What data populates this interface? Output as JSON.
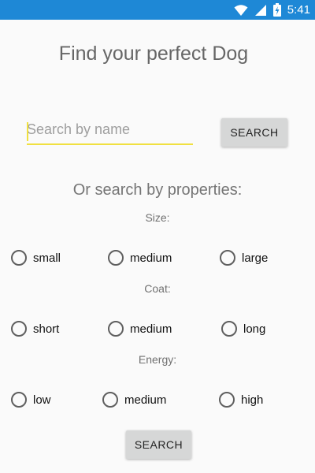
{
  "status_bar": {
    "time": "5:41",
    "icons": [
      "wifi-icon",
      "signal-icon",
      "battery-charging-icon"
    ],
    "color": "#1e88d6"
  },
  "title": "Find your perfect Dog",
  "search": {
    "placeholder": "Search by name",
    "value": "",
    "button_label": "SEARCH"
  },
  "properties_heading": "Or search by properties:",
  "groups": {
    "size": {
      "label": "Size:",
      "options": [
        "small",
        "medium",
        "large"
      ]
    },
    "coat": {
      "label": "Coat:",
      "options": [
        "short",
        "medium",
        "long"
      ]
    },
    "energy": {
      "label": "Energy:",
      "options": [
        "low",
        "medium",
        "high"
      ]
    }
  },
  "bottom_button_label": "SEARCH",
  "accent_color": "#f0e040"
}
